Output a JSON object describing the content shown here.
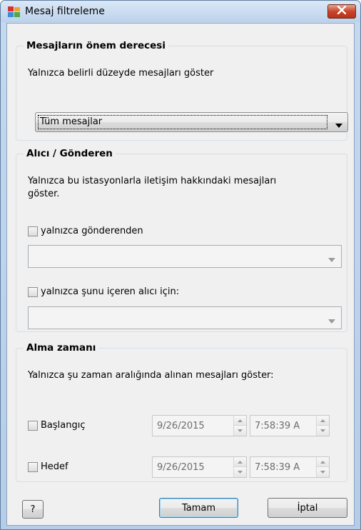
{
  "window": {
    "title": "Mesaj filtreleme",
    "icon": "avg-logo-icon",
    "close_icon": "close-icon"
  },
  "severity_group": {
    "title": "Mesajların önem derecesi",
    "description": "Yalnızca belirli düzeyde mesajları göster",
    "select_value": "Tüm mesajlar"
  },
  "recipient_group": {
    "title": "Alıcı / Gönderen",
    "description_line1": "Yalnızca bu istasyonlarla iletişim hakkındaki mesajları",
    "description_line2": "göster.",
    "sender_checkbox_label": "yalnızca gönderenden",
    "sender_value": "",
    "recipient_checkbox_label": "yalnızca şunu içeren alıcı için:",
    "recipient_value": ""
  },
  "time_group": {
    "title": "Alma zamanı",
    "description": "Yalnızca şu zaman aralığında alınan mesajları göster:",
    "start_label": "Başlangıç",
    "start_date": "9/26/2015",
    "start_time": "7:58:39 A",
    "end_label": "Hedef",
    "end_date": "9/26/2015",
    "end_time": "7:58:39 A"
  },
  "buttons": {
    "help": "?",
    "ok": "Tamam",
    "cancel": "İptal"
  }
}
